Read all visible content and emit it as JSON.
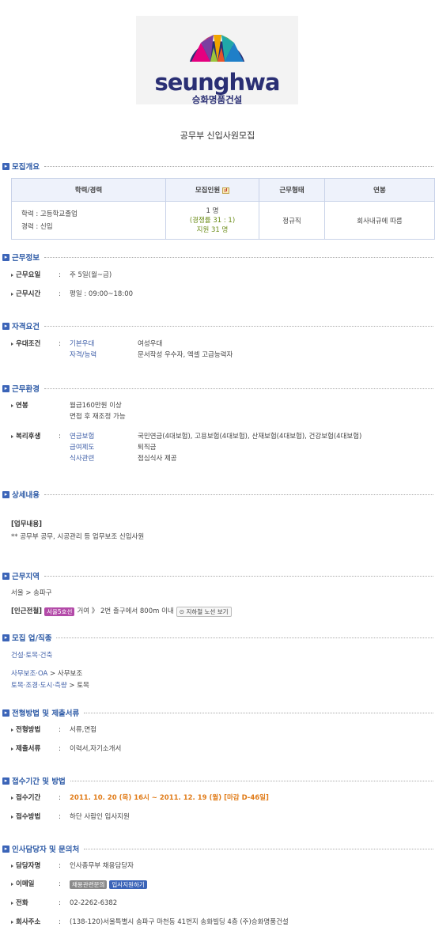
{
  "logo": {
    "word": "seunghwa",
    "korean": "승화명품건설"
  },
  "title": "공무부 신입사원모집",
  "sections": {
    "overview": "모집개요",
    "work_info": "근무정보",
    "qualification": "자격요건",
    "environment": "근무환경",
    "detail": "상세내용",
    "region": "근무지역",
    "industry": "모집 업/직종",
    "process": "전형방법 및 제출서류",
    "period": "접수기간 및 방법",
    "contact": "인사담당자 및 문의처"
  },
  "summary": {
    "headers": [
      "학력/경력",
      "모집인원",
      "근무형태",
      "연봉"
    ],
    "education": "학력 : 고등학교졸업",
    "career": "경력 : 신입",
    "count": "1 명",
    "ratio": "(경쟁률 31 : 1)",
    "applicants": "지원 31 명",
    "type": "정규직",
    "salary": "회사내규에 따름"
  },
  "work": {
    "days_label": "근무요일",
    "days": "주 5일(월~금)",
    "hours_label": "근무시간",
    "hours": "평일 : 09:00~18:00"
  },
  "qual": {
    "label": "우대조건",
    "basic_label": "기본우대",
    "basic": "여성우대",
    "cert_label": "자격/능력",
    "cert": "문서작성 우수자, 엑셀 고급능력자"
  },
  "env": {
    "salary_label": "연봉",
    "salary1": "월급160만원 이상",
    "salary2": "면접 후 재조정 가능",
    "welfare_label": "복리후생",
    "pension_label": "연금보험",
    "pension": "국민연금(4대보험), 고용보험(4대보험), 산재보험(4대보험), 건강보험(4대보험)",
    "pay_label": "급여제도",
    "pay": "퇴직금",
    "meal_label": "식사관련",
    "meal": "점심식사 제공"
  },
  "detail": {
    "heading": "[업무내용]",
    "text": "** 공무부 공무, 시공관리 등 업무보조 신입사원"
  },
  "region": {
    "path": "서울 > 송파구",
    "station_label": "[인근전철]",
    "line": "서울5호선",
    "station": "거여 》 2번 출구에서 800m 이내",
    "map_button": "지하철 노선 보기"
  },
  "industry": {
    "line1": "건설·토목·건축",
    "line2a": "사무보조·OA",
    "line2b": " >  사무보조",
    "line3a": "토목·조경·도시·측량",
    "line3b": " >  토목"
  },
  "process": {
    "method_label": "전형방법",
    "method": "서류,면접",
    "docs_label": "제출서류",
    "docs": "이력서,자기소개서"
  },
  "period": {
    "date_label": "접수기간",
    "dates": "2011. 10. 20 (목) 16시 ~ 2011. 12. 19 (월) [마감 D-46일]",
    "how_label": "접수방법",
    "how": "하단 사람인 입사지원"
  },
  "contact": {
    "person_label": "담당자명",
    "person": "인사총무부 채용담당자",
    "email_label": "이메일",
    "email_btn1": "채용관련문의",
    "email_btn2": "입사지원하기",
    "phone_label": "전화",
    "phone": "02-2262-6382",
    "addr_label": "회사주소",
    "addr": "(138-120)서울특별시 송파구 마천동 41번지 송화빌딩 4층 (주)승화명품건설"
  },
  "colors": {
    "accent": "#2d5aa6",
    "logo_navy": "#2a2f74",
    "deadline": "#e07b18",
    "subway_badge": "#b34aa8",
    "apply_badge": "#3b64b8"
  }
}
